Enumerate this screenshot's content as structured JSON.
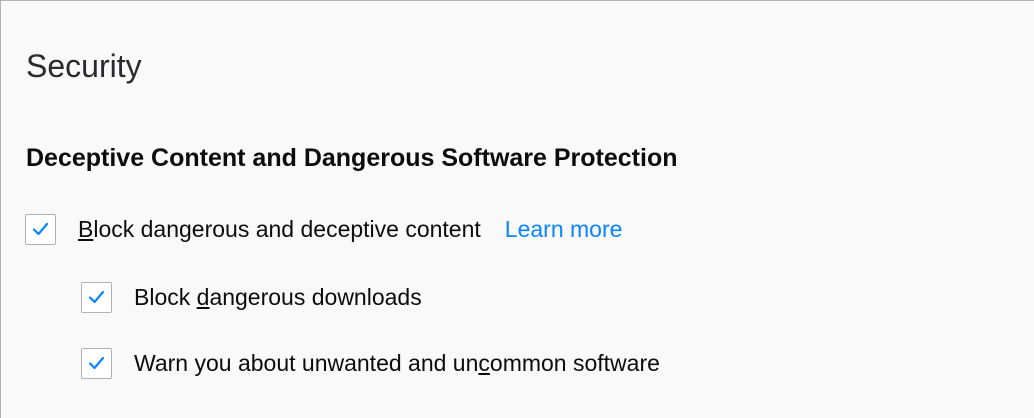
{
  "section": {
    "title": "Security"
  },
  "group": {
    "heading": "Deceptive Content and Dangerous Software Protection"
  },
  "options": [
    {
      "label_before": "",
      "accesskey": "B",
      "label_after": "lock dangerous and deceptive content",
      "checked": true,
      "learn_more": "Learn more"
    },
    {
      "label_before": "Block ",
      "accesskey": "d",
      "label_after": "angerous downloads",
      "checked": true
    },
    {
      "label_before": "Warn you about unwanted and un",
      "accesskey": "c",
      "label_after": "ommon software",
      "checked": true
    }
  ],
  "colors": {
    "checkmark": "#0a84ff",
    "link": "#0a84ff",
    "background": "#f9f9fa"
  },
  "icons": {
    "checkbox": "checkmark-icon"
  }
}
